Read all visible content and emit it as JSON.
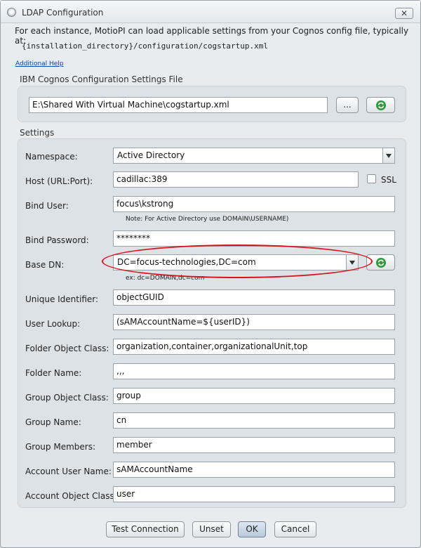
{
  "window": {
    "title": "LDAP Configuration",
    "close_label": "✕"
  },
  "intro": {
    "text": "For each instance, MotioPI can load applicable settings from your Cognos config file, typically at:",
    "path": "{installation_directory}/configuration/cogstartup.xml",
    "help_link": "Additional Help"
  },
  "config_file": {
    "section_label": "IBM Cognos Configuration Settings File",
    "path_value": "E:\\Shared With Virtual Machine\\cogstartup.xml",
    "browse_label": "...",
    "reload_icon": "refresh-icon"
  },
  "settings": {
    "section_label": "Settings",
    "namespace": {
      "label": "Namespace:",
      "value": "Active Directory"
    },
    "host": {
      "label": "Host (URL:Port):",
      "value": "cadillac:389",
      "ssl_label": "SSL",
      "ssl_checked": false
    },
    "bind_user": {
      "label": "Bind User:",
      "value": "focus\\kstrong",
      "note": "Note: For Active Directory use DOMAIN\\USERNAME)"
    },
    "bind_password": {
      "label": "Bind Password:",
      "value": "********"
    },
    "base_dn": {
      "label": "Base DN:",
      "value": "DC=focus-technologies,DC=com",
      "example": "ex: dc=DOMAIN,dc=com",
      "refresh_icon": "refresh-icon"
    },
    "unique_identifier": {
      "label": "Unique Identifier:",
      "value": "objectGUID"
    },
    "user_lookup": {
      "label": "User Lookup:",
      "value": "(sAMAccountName=${userID})"
    },
    "folder_object_class": {
      "label": "Folder Object Class:",
      "value": "organization,container,organizationalUnit,top"
    },
    "folder_name": {
      "label": "Folder Name:",
      "value": ",,,"
    },
    "group_object_class": {
      "label": "Group Object Class:",
      "value": "group"
    },
    "group_name": {
      "label": "Group Name:",
      "value": "cn"
    },
    "group_members": {
      "label": "Group Members:",
      "value": "member"
    },
    "account_user_name": {
      "label": "Account User Name:",
      "value": "sAMAccountName"
    },
    "account_object_class": {
      "label": "Account Object Class:",
      "value": "user"
    }
  },
  "footer": {
    "test_connection": "Test Connection",
    "unset": "Unset",
    "ok": "OK",
    "cancel": "Cancel"
  },
  "colors": {
    "highlight": "#d5141b",
    "refresh_icon": "#2f9a3a",
    "link": "#0b3fbf"
  }
}
